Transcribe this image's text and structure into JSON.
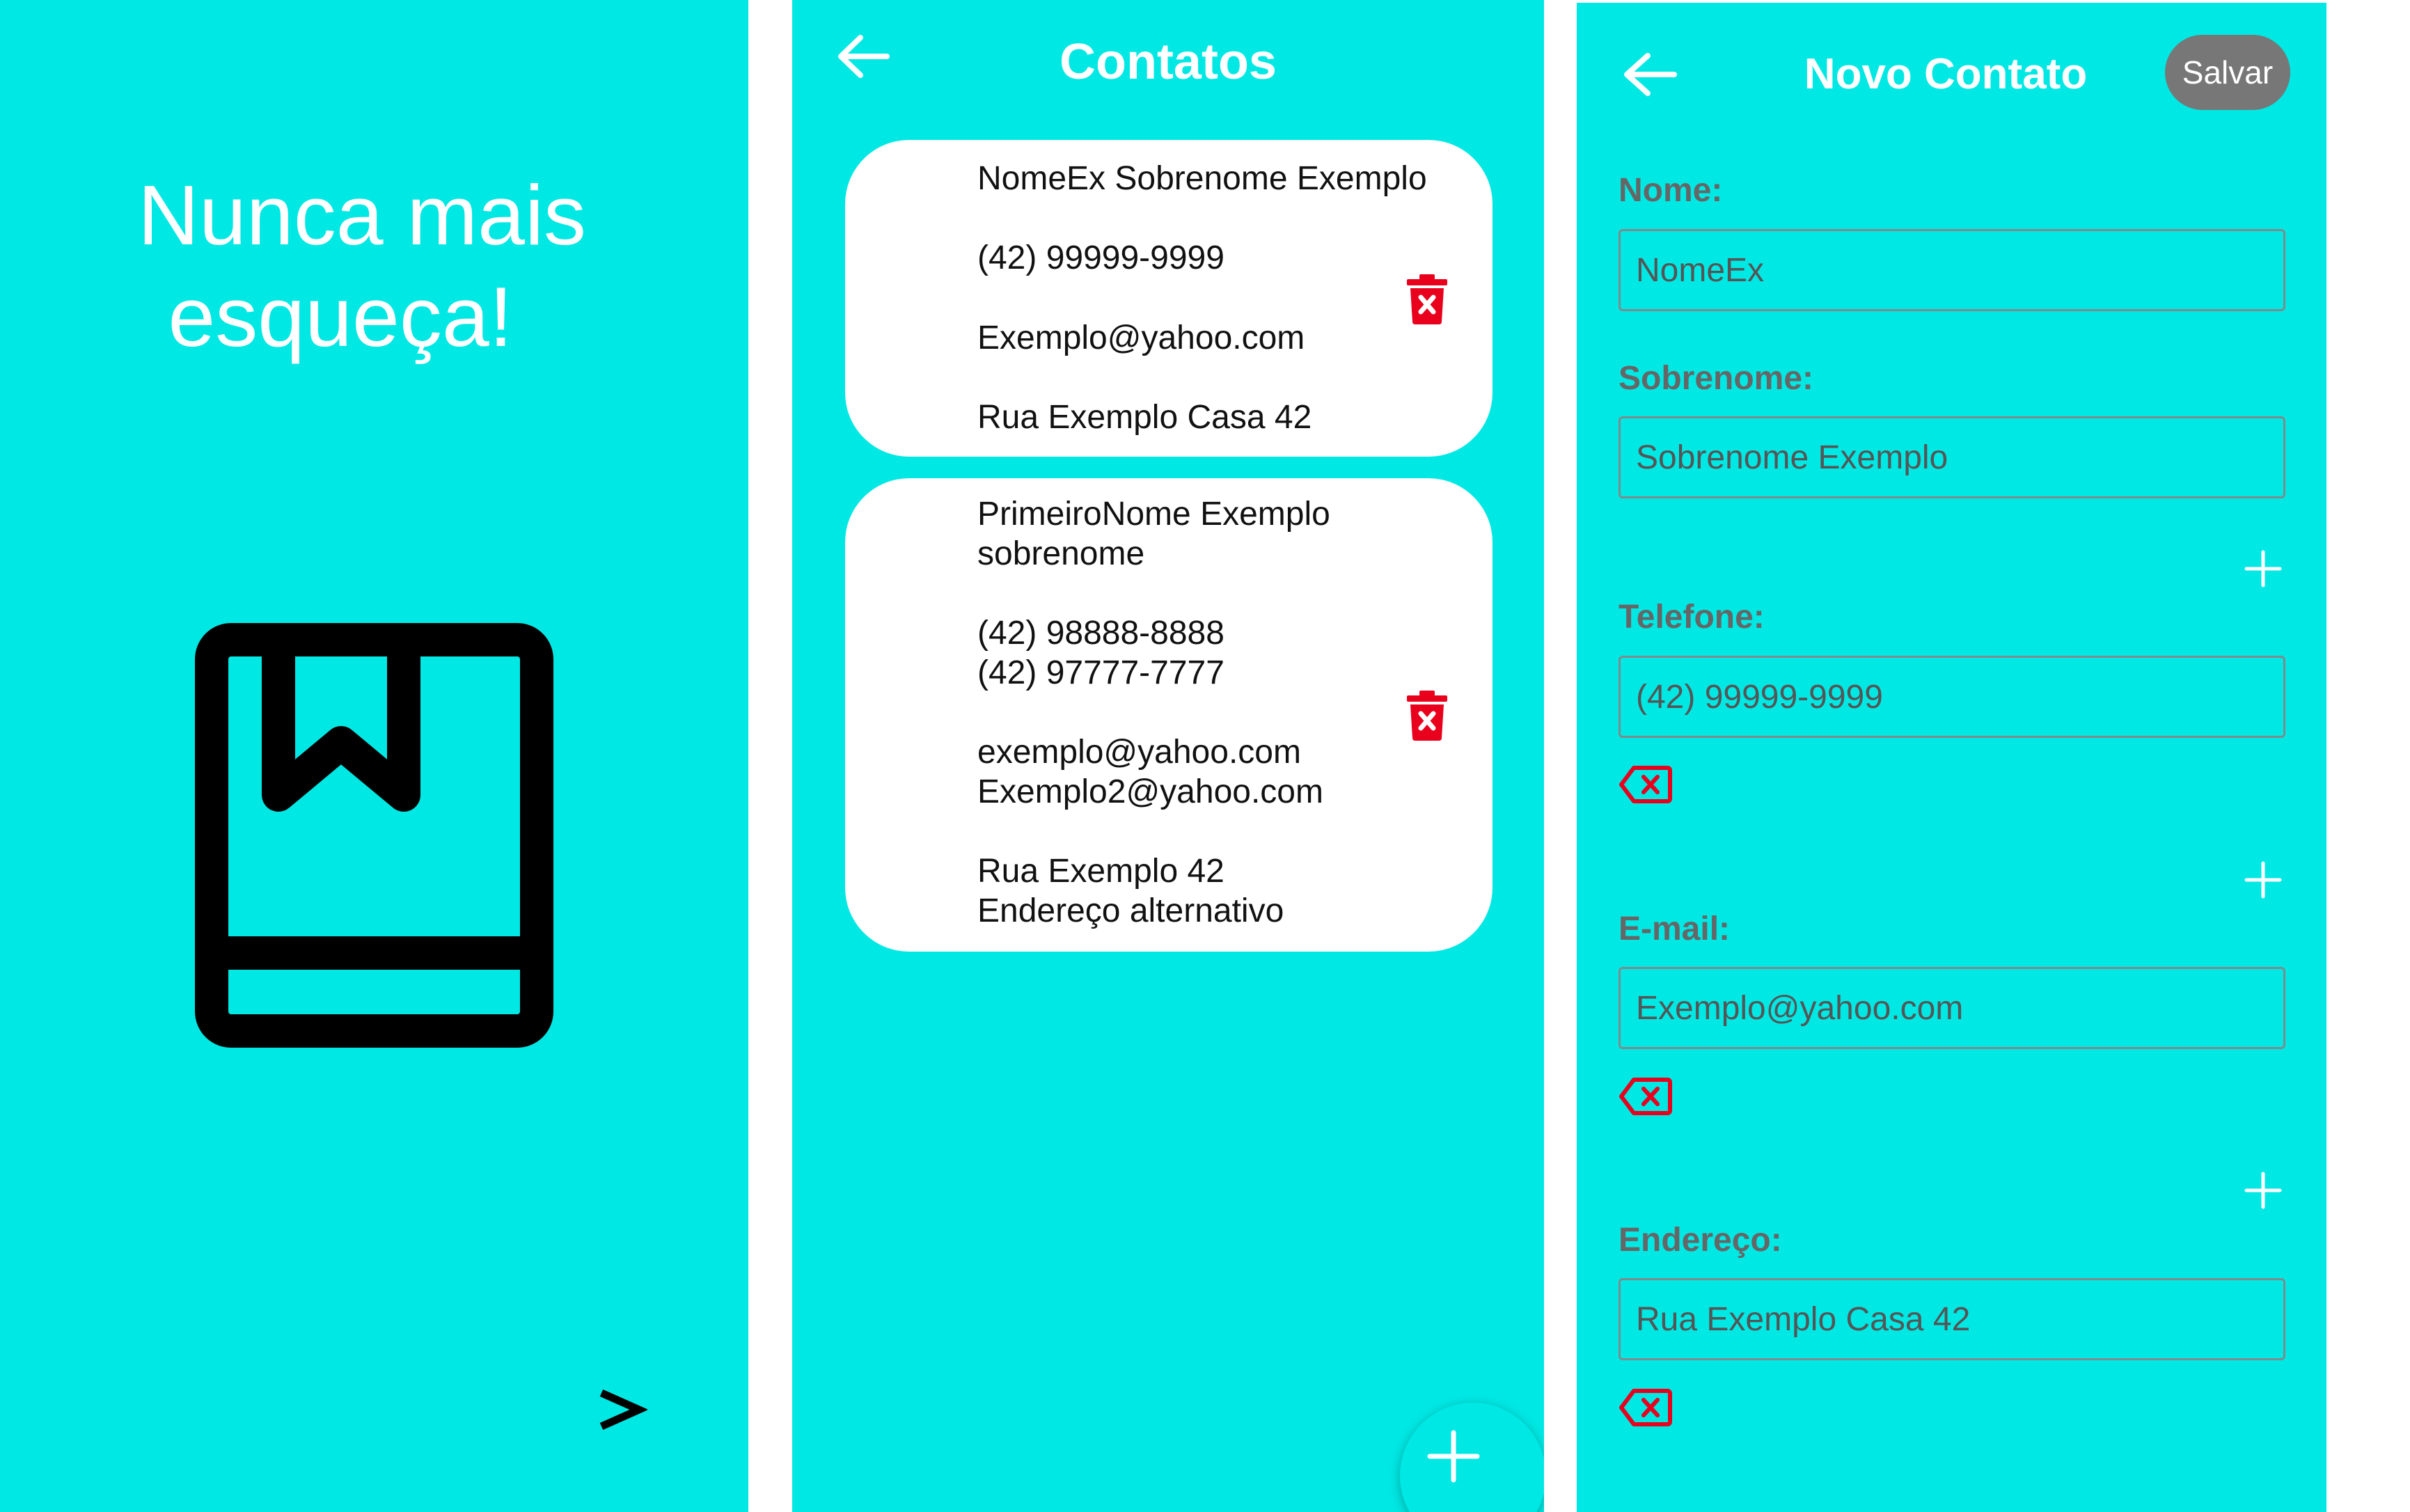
{
  "colors": {
    "background": "#00E8E4",
    "danger": "#E8001C",
    "save_button": "#777777",
    "label": "#666666"
  },
  "onboarding": {
    "tagline_line1": "Nunca mais",
    "tagline_line2": "esqueça!",
    "illustration": "book-bookmark-icon",
    "next_label": ">"
  },
  "contacts_screen": {
    "title": "Contatos",
    "back_icon": "arrow-left-icon",
    "delete_icon": "trash-icon",
    "add_icon": "plus-icon",
    "contacts": [
      {
        "lines": [
          "NomeEx Sobrenome Exemplo",
          "(42) 99999-9999",
          "Exemplo@yahoo.com",
          "Rua Exemplo Casa 42"
        ]
      },
      {
        "lines": [
          "PrimeiroNome Exemplo",
          "sobrenome",
          "(42) 98888-8888",
          "(42) 97777-7777",
          "exemplo@yahoo.com",
          "Exemplo2@yahoo.com",
          "Rua Exemplo 42",
          "Endereço alternativo"
        ]
      }
    ]
  },
  "new_contact_screen": {
    "title": "Novo Contato",
    "save_label": "Salvar",
    "back_icon": "arrow-left-icon",
    "add_icon": "plus-icon",
    "remove_icon": "backspace-x-icon",
    "fields": {
      "nome": {
        "label": "Nome:",
        "value": "NomeEx"
      },
      "sobrenome": {
        "label": "Sobrenome:",
        "value": "Sobrenome Exemplo"
      },
      "telefone": {
        "label": "Telefone:",
        "value": "(42) 99999-9999"
      },
      "email": {
        "label": "E-mail:",
        "value": "Exemplo@yahoo.com"
      },
      "endereco": {
        "label": "Endereço:",
        "value": "Rua Exemplo Casa 42"
      }
    }
  }
}
